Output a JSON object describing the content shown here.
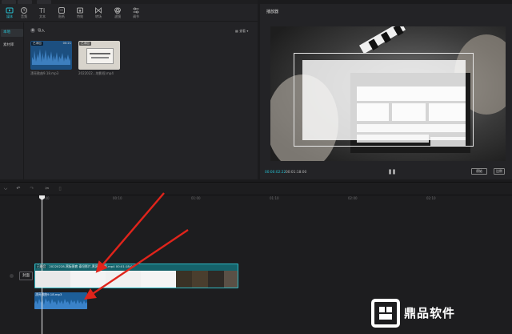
{
  "media": {
    "tabs": [
      {
        "label": "媒体"
      },
      {
        "label": "音频"
      },
      {
        "label": "文本"
      },
      {
        "label": "贴纸"
      },
      {
        "label": "特效"
      },
      {
        "label": "转场"
      },
      {
        "label": "滤镜"
      },
      {
        "label": "调节"
      }
    ],
    "sidebar": [
      {
        "label": "本地"
      },
      {
        "label": "素材库"
      }
    ],
    "import_label": "导入",
    "sort_label": "查看",
    "cards": [
      {
        "tag": "已添加",
        "duration": "00:21",
        "name": "漂亮歌曲9.18.mp3"
      },
      {
        "tag": "已添加",
        "duration": "",
        "name": "2022022...地影视.mp4"
      }
    ]
  },
  "player": {
    "title": "播放器",
    "current_time": "00:00:02:22",
    "total_time": "00:01:18:00",
    "btn_original": "原始",
    "btn_ratio": "比例"
  },
  "timeline": {
    "ticks": [
      "00:00",
      "00:10",
      "01:00",
      "01:10",
      "02:00",
      "02:10"
    ],
    "cover_label": "封面",
    "video_clip": {
      "tag": "已静音",
      "label": "20220228-黑板图套 泰坦影片,黑洞是影视.mp4  00:01:18:00"
    },
    "audio_clip": {
      "label": "漂亮歌曲9.18.mp3"
    }
  },
  "watermark": {
    "text": "鼎品软件"
  },
  "colors": {
    "accent": "#27c0d2",
    "video_clip": "#15626a",
    "audio_clip": "#1d5e98",
    "arrow": "#e0241b"
  }
}
